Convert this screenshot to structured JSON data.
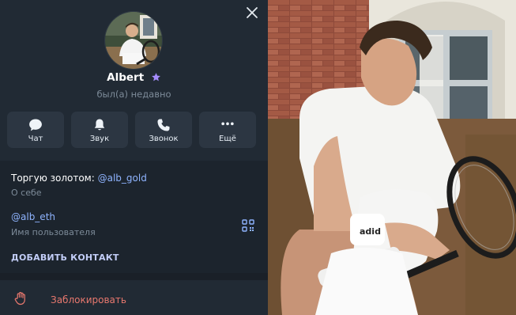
{
  "profile": {
    "name": "Albert",
    "status": "был(а) недавно"
  },
  "actions": [
    {
      "label": "Чат",
      "icon": "chat-bubble-icon"
    },
    {
      "label": "Звук",
      "icon": "bell-icon"
    },
    {
      "label": "Звонок",
      "icon": "phone-icon"
    },
    {
      "label": "Ещё",
      "icon": "more-dots-icon"
    }
  ],
  "info": {
    "bio_text": "Торгую золотом: ",
    "bio_link": "@alb_gold",
    "bio_caption": "О себе",
    "username": "@alb_eth",
    "username_caption": "Имя пользователя",
    "add_contact": "ДОБАВИТЬ КОНТАКТ"
  },
  "block": {
    "label": "Заблокировать"
  },
  "colors": {
    "panel_bg": "#212a34",
    "button_bg": "#2c3642",
    "link": "#8fb4ff",
    "premium_star": "#a58cff",
    "danger": "#e8786e"
  }
}
